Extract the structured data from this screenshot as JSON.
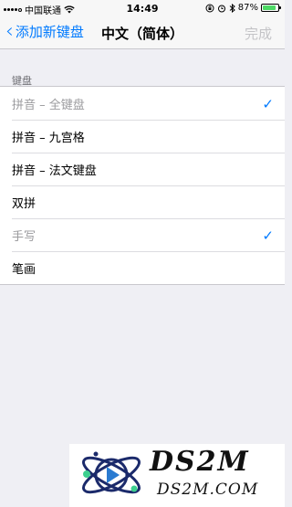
{
  "status_bar": {
    "carrier": "中国联通",
    "time": "14:49",
    "battery_text": "87%",
    "battery_level": 0.87,
    "icons": [
      "signal-icon",
      "wifi-icon",
      "lock-rotation-icon",
      "alarm-icon",
      "bluetooth-icon",
      "battery-icon"
    ]
  },
  "nav": {
    "back_label": "添加新键盘",
    "title": "中文（简体）",
    "done_label": "完成"
  },
  "section": {
    "header": "键盘",
    "items": [
      {
        "label": "拼音 – 全键盘",
        "checked": true,
        "dim": true
      },
      {
        "label": "拼音 – 九宫格",
        "checked": false,
        "dim": false
      },
      {
        "label": "拼音 – 法文键盘",
        "checked": false,
        "dim": false
      },
      {
        "label": "双拼",
        "checked": false,
        "dim": false
      },
      {
        "label": "手写",
        "checked": true,
        "dim": true
      },
      {
        "label": "笔画",
        "checked": false,
        "dim": false
      }
    ]
  },
  "watermark": {
    "title": "DS2M",
    "subtitle": "DS2M.COM"
  },
  "colors": {
    "accent": "#007aff",
    "battery": "#4cd964",
    "background": "#efeff4"
  }
}
